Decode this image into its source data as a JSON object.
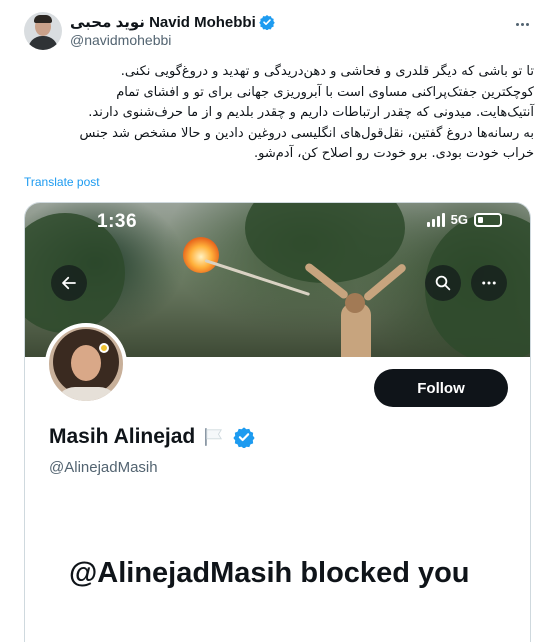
{
  "post": {
    "author_name": "نوید محبی Navid Mohebbi",
    "author_handle": "@navidmohebbi",
    "text_lines": [
      "تا تو باشی که دیگر قلدری و فحاشی و دهن‌دریدگی و تهدید و دروغ‌گویی نکنی.",
      "کوچکترین جفتک‌پراکنی مساوی است با آبروریزی جهانی برای تو و افشای تمام",
      "آنتیک‌هایت. میدونی که چقدر ارتباطات داریم و چقدر بلدیم و از ما حرف‌شنوی دارند.",
      "به رسانه‌ها دروغ گفتین، نقل‌قول‌های انگلیسی دروغین دادین و حالا مشخص شد جنس",
      "خراب خودت بودی. برو خودت رو اصلاح کن، آدم‌شو."
    ],
    "translate_label": "Translate post"
  },
  "screenshot": {
    "status_time": "1:36",
    "network_label": "5G",
    "profile": {
      "name": "Masih Alinejad",
      "handle": "@AlinejadMasih",
      "follow_label": "Follow"
    },
    "blocked_message": "@AlinejadMasih blocked you"
  },
  "colors": {
    "accent": "#1d9bf0",
    "text": "#0f1419",
    "muted": "#536471",
    "follow_bg": "#0f1419"
  },
  "icons": {
    "verified": "verified-badge-icon",
    "more": "more-horizontal-icon",
    "back": "back-arrow-icon",
    "search": "search-icon",
    "flag": "white-flag-icon"
  }
}
